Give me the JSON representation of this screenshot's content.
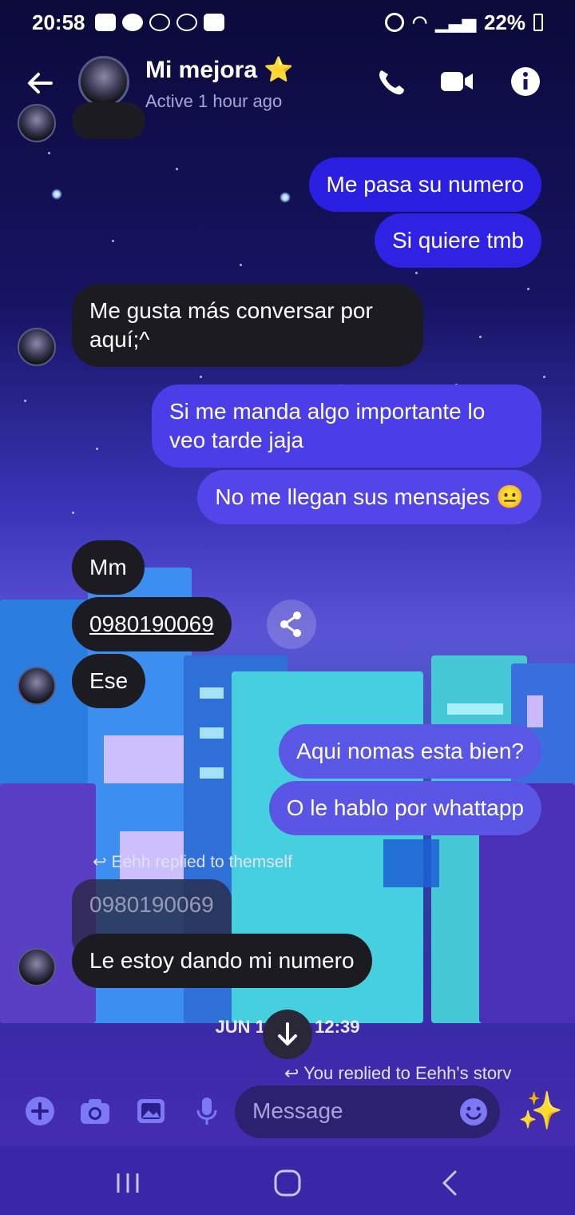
{
  "status_bar": {
    "time": "20:58",
    "battery": "22%"
  },
  "header": {
    "contact_name": "Mi mejora ⭐",
    "presence": "Active 1 hour ago"
  },
  "messages": [
    {
      "direction": "out",
      "text": "Me pasa su numero",
      "color": "#2a1fe0"
    },
    {
      "direction": "out",
      "text": "Si quiere tmb",
      "color": "#2f22e3"
    },
    {
      "direction": "in",
      "text": "Me gusta más conversar por\naquí;^"
    },
    {
      "direction": "out",
      "text": "Si me manda algo importante lo\nveo tarde jaja",
      "color": "#4b3de8"
    },
    {
      "direction": "out",
      "text": "No me llegan sus mensajes 😐",
      "color": "#5445ea"
    },
    {
      "direction": "in",
      "text": "Mm"
    },
    {
      "direction": "in",
      "text": "0980190069",
      "link": true
    },
    {
      "direction": "in",
      "text": "Ese"
    },
    {
      "direction": "out",
      "text": "Aqui nomas esta bien?",
      "color": "#5b57e6"
    },
    {
      "direction": "out",
      "text": "O le hablo por whattapp",
      "color": "#5a55e4"
    },
    {
      "direction": "in",
      "text": "0980190069",
      "quoted": true,
      "reply_label": "Eehh replied to themself"
    },
    {
      "direction": "in",
      "text": "Le estoy dando mi numero"
    }
  ],
  "date_separator": {
    "left": "JUN 1",
    "right": "12:39"
  },
  "story_reply_label": "You replied to Eehh's story",
  "composer": {
    "placeholder": "Message",
    "sparkle": "✨"
  },
  "colors": {
    "accent": "#6f6bf2",
    "incoming_bubble": "#1c1b22"
  }
}
